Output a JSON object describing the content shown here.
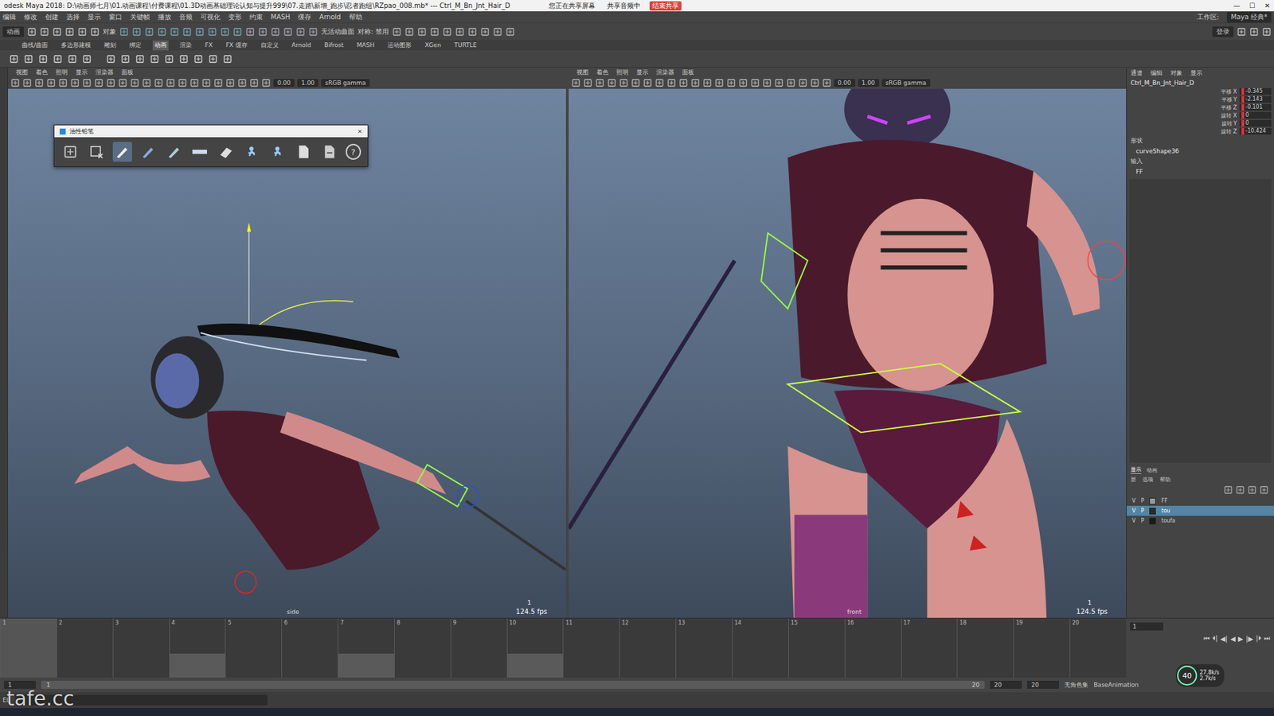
{
  "window": {
    "title": "odesk Maya 2018: D:\\动画师七月\\01.动画课程\\付费课程\\01.3D动画基础理论认知与提升999\\07.走路\\新增_跑步\\忍者跑组\\RZpao_008.mb* --- Ctrl_M_Bn_Jnt_Hair_D",
    "sharing": [
      "您正在共享屏幕",
      "共享音频中",
      "结束共享"
    ],
    "controls": [
      "—",
      "☐",
      "✕"
    ]
  },
  "menus": [
    "编辑",
    "修改",
    "创建",
    "选择",
    "显示",
    "窗口",
    "关键帧",
    "播放",
    "音频",
    "可视化",
    "变形",
    "约束",
    "MASH",
    "缓存",
    "Arnold",
    "帮助"
  ],
  "workspace": {
    "label": "工作区:",
    "value": "Maya 经典*"
  },
  "status_line": {
    "mode": "动画",
    "object": "对象",
    "surface": "无活动曲面",
    "symmetry": "对称: 禁用",
    "login": "登录"
  },
  "shelf_tabs": [
    {
      "label": "曲线/曲面",
      "selected": false
    },
    {
      "label": "多边形建模",
      "selected": false
    },
    {
      "label": "雕刻",
      "selected": false
    },
    {
      "label": "绑定",
      "selected": false
    },
    {
      "label": "动画",
      "selected": true
    },
    {
      "label": "渲染",
      "selected": false
    },
    {
      "label": "FX",
      "selected": false
    },
    {
      "label": "FX 缓存",
      "selected": false
    },
    {
      "label": "自定义",
      "selected": false
    },
    {
      "label": "Arnold",
      "selected": false
    },
    {
      "label": "Bifrost",
      "selected": false
    },
    {
      "label": "MASH",
      "selected": false
    },
    {
      "label": "运动图形",
      "selected": false
    },
    {
      "label": "XGen",
      "selected": false
    },
    {
      "label": "TURTLE",
      "selected": false
    }
  ],
  "viewports": [
    {
      "menus": [
        "视图",
        "着色",
        "照明",
        "显示",
        "渲染器",
        "面板"
      ],
      "exposure": "0.00",
      "gamma": "1.00",
      "color_space": "sRGB gamma",
      "camera": "side",
      "frame": "1",
      "fps": "124.5 fps"
    },
    {
      "menus": [
        "视图",
        "着色",
        "照明",
        "显示",
        "渲染器",
        "面板"
      ],
      "exposure": "0.00",
      "gamma": "1.00",
      "color_space": "sRGB gamma",
      "camera": "front",
      "frame": "1",
      "fps": "124.5 fps"
    }
  ],
  "grease_pencil": {
    "title": "油性铅笔",
    "close": "×",
    "tools": [
      {
        "kind": "blank",
        "selected": false
      },
      {
        "kind": "select",
        "selected": false
      },
      {
        "kind": "pencil",
        "selected": true
      },
      {
        "kind": "marker",
        "selected": false
      },
      {
        "kind": "brush",
        "selected": false
      },
      {
        "kind": "bar",
        "selected": false
      },
      {
        "kind": "eraser",
        "selected": false
      },
      {
        "kind": "ghost",
        "selected": false
      },
      {
        "kind": "ghost",
        "selected": false
      },
      {
        "kind": "import",
        "selected": false
      },
      {
        "kind": "export",
        "selected": false
      }
    ],
    "help": "?"
  },
  "channel_box": {
    "menus": [
      "通道",
      "编辑",
      "对象",
      "显示"
    ],
    "node": "Ctrl_M_Bn_Jnt_Hair_D",
    "channels": [
      {
        "name": "平移 X",
        "value": "-0.345",
        "keyed": true
      },
      {
        "name": "平移 Y",
        "value": "-2.143",
        "keyed": true
      },
      {
        "name": "平移 Z",
        "value": "-0.101",
        "keyed": true
      },
      {
        "name": "旋转 X",
        "value": "0",
        "keyed": true
      },
      {
        "name": "旋转 Y",
        "value": "0",
        "keyed": true
      },
      {
        "name": "旋转 Z",
        "value": "-10.424",
        "keyed": true
      }
    ],
    "shapes_label": "形状",
    "shape": "curveShape36",
    "inputs_label": "输入",
    "input": "FF"
  },
  "layers": {
    "tabs": [
      {
        "label": "显示",
        "selected": true
      },
      {
        "label": "动画",
        "selected": false
      }
    ],
    "menus": [
      "层",
      "选项",
      "帮助"
    ],
    "items": [
      {
        "v": "V",
        "p": "P",
        "name": "FF",
        "selected": false,
        "color": "#9a9a9a"
      },
      {
        "v": "V",
        "p": "P",
        "name": "tou",
        "selected": true,
        "color": "#2a2a2a"
      },
      {
        "v": "V",
        "p": "P",
        "name": "toufa",
        "selected": false,
        "color": "#1a1a1a"
      }
    ]
  },
  "timeline": {
    "ticks": [
      "1",
      "2",
      "3",
      "4",
      "5",
      "6",
      "7",
      "8",
      "9",
      "10",
      "11",
      "12",
      "13",
      "14",
      "15",
      "16",
      "17",
      "18",
      "19",
      "20"
    ],
    "current": "1",
    "key_frames": [
      "4",
      "7",
      "10"
    ],
    "current_field": "1",
    "buttons": [
      "⏮",
      "⏴|",
      "◀|",
      "◀",
      "▶",
      "|▶",
      "|⏵",
      "⏭"
    ]
  },
  "range": {
    "start": "1",
    "range_start": "1",
    "range_end": "20",
    "end_a": "20",
    "end_b": "20",
    "character_set": "无角色集",
    "anim_layer": "BaseAnimation"
  },
  "command": {
    "label": "EL"
  },
  "perf": {
    "percent": "40",
    "up": "27.8k/s",
    "down": "2.7k/s"
  },
  "watermark": "tafe.cc"
}
